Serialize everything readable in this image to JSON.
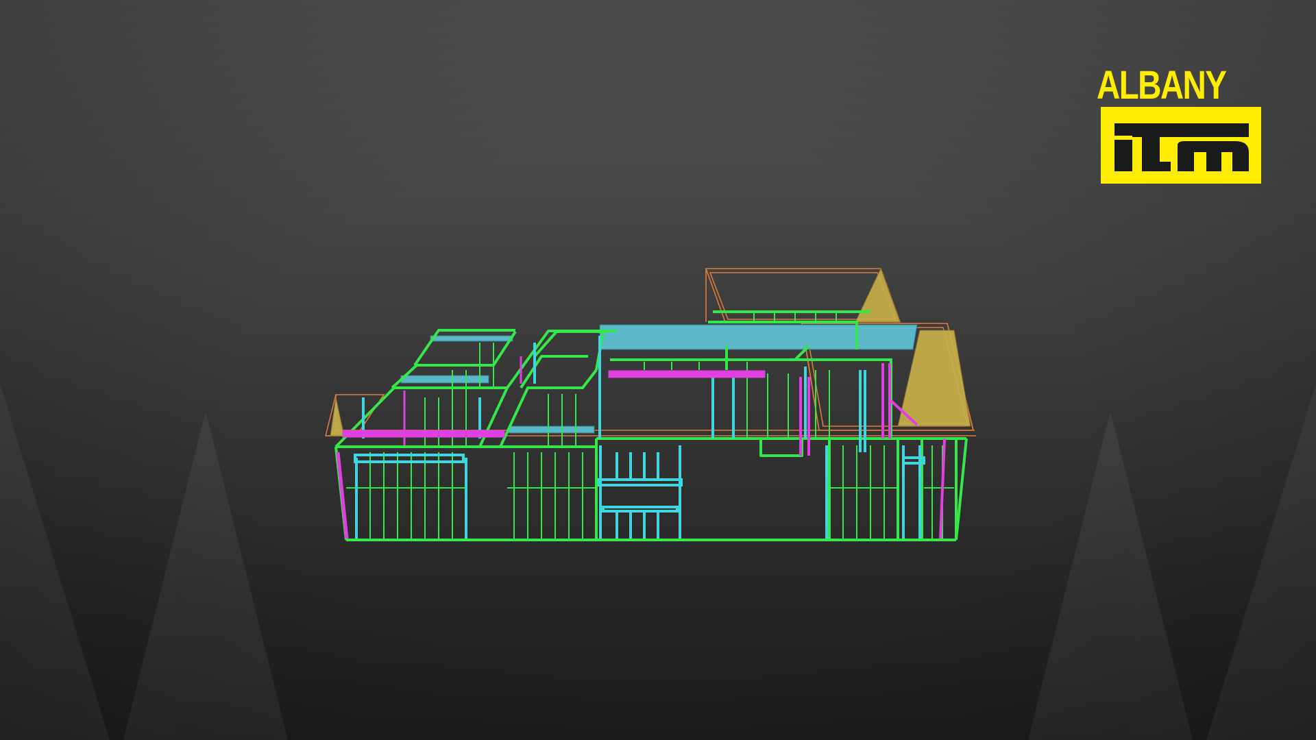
{
  "brand": {
    "name": "ALBANY",
    "mark": "itm",
    "color": "#ffed00",
    "mark_color": "#1a1a1a"
  },
  "model": {
    "colors": {
      "wall_frame": "#35e84a",
      "stud": "#3fd6e0",
      "lintel": "#e040e0",
      "roof_truss": "#e07a3a",
      "gable": "#c8b04a",
      "beam": "#5ab8c8"
    }
  }
}
